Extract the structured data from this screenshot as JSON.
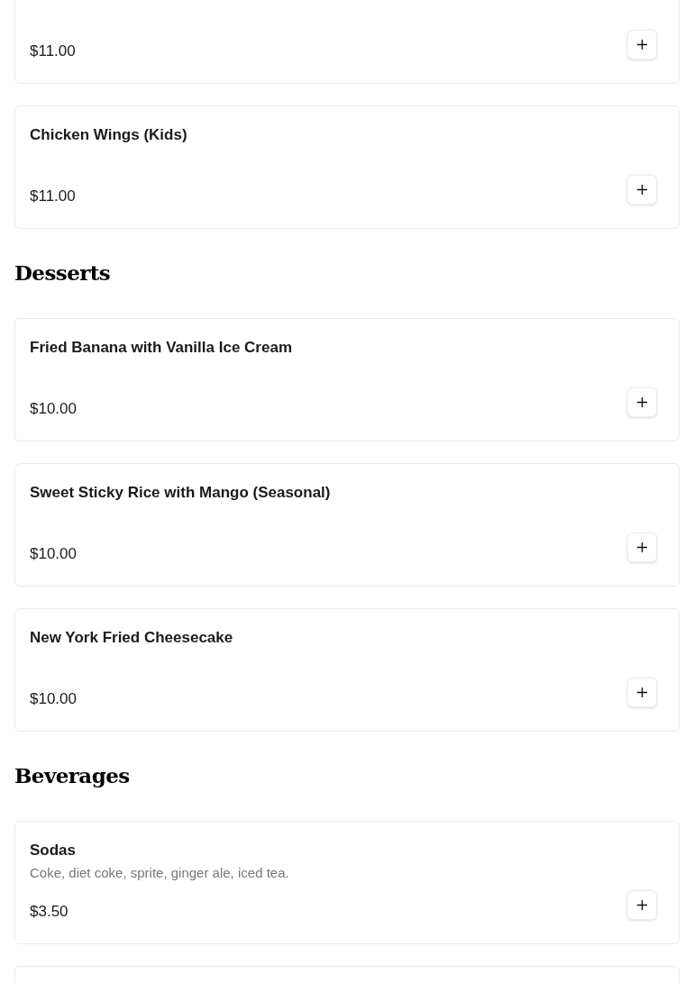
{
  "sections": [
    {
      "items": [
        {
          "kind": "item",
          "price": "$11.00"
        },
        {
          "kind": "item",
          "name": "Chicken Wings (Kids)",
          "price": "$11.00"
        }
      ]
    },
    {
      "heading": "Desserts",
      "items": [
        {
          "kind": "item",
          "name": "Fried Banana with Vanilla Ice Cream",
          "price": "$10.00"
        },
        {
          "kind": "item",
          "name": "Sweet Sticky Rice with Mango (Seasonal)",
          "price": "$10.00"
        },
        {
          "kind": "item",
          "name": "New York Fried Cheesecake",
          "price": "$10.00"
        }
      ]
    },
    {
      "heading": "Beverages",
      "items": [
        {
          "kind": "item",
          "name": "Sodas",
          "description": "Coke, diet coke, sprite, ginger ale, iced tea.",
          "price": "$3.50"
        },
        {
          "kind": "blank"
        }
      ]
    }
  ]
}
